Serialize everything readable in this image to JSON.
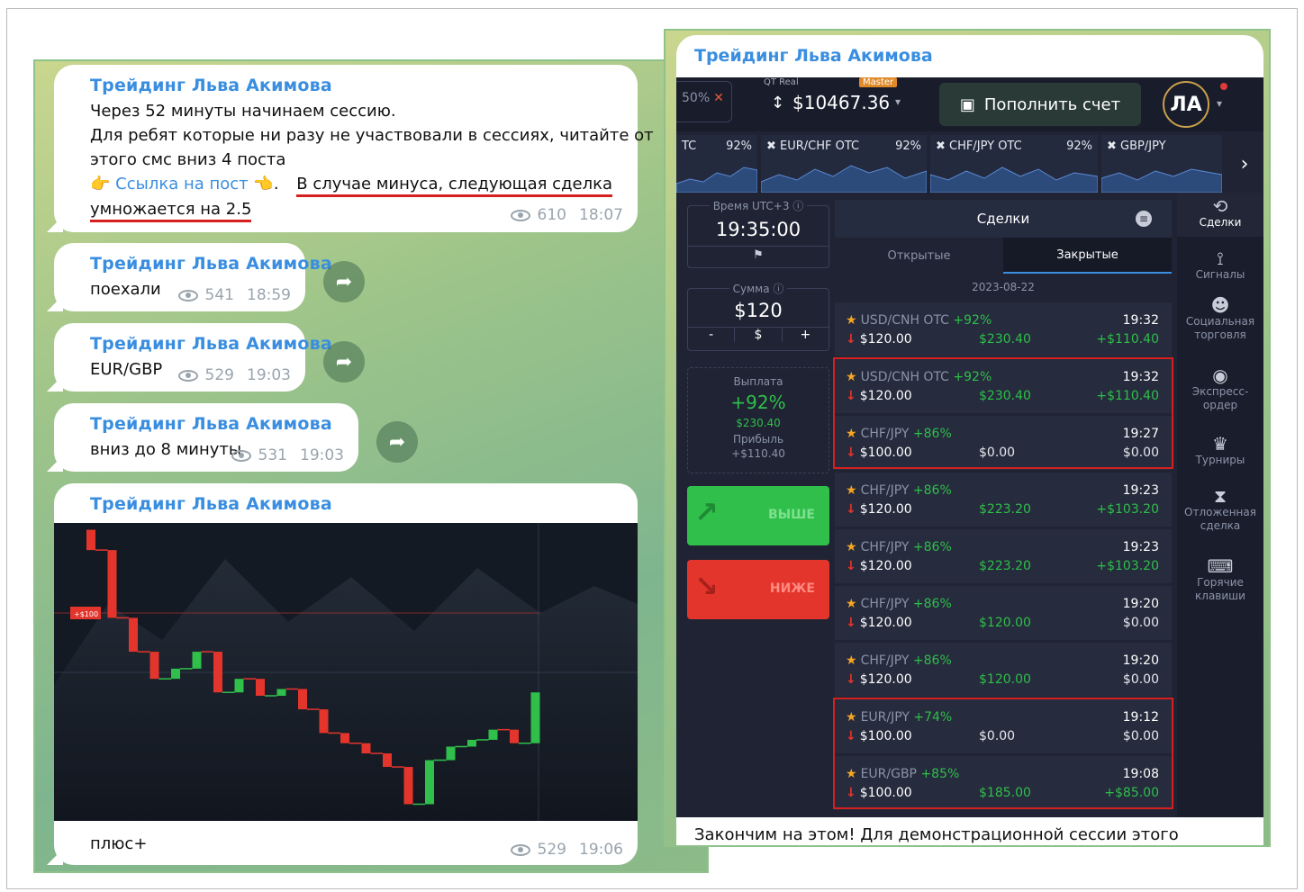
{
  "channel": "Трейдинг Льва Акимова",
  "messages": [
    {
      "lines": [
        "Через 52 минуты начинаем сессию.",
        "Для ребят которые ни разу не участвовали в сессиях, читайте от",
        "этого смс вниз 4 поста"
      ],
      "link_text": "Ссылка на пост",
      "highlight1": "В случае минуса, следующая сделка",
      "highlight2": "умножается на 2.5",
      "views": "610",
      "time": "18:07"
    },
    {
      "text": "поехали",
      "views": "541",
      "time": "18:59"
    },
    {
      "text": "EUR/GBP",
      "views": "529",
      "time": "19:03"
    },
    {
      "text": "вниз до 8 минуты",
      "views": "531",
      "time": "19:03"
    },
    {
      "text": "плюс+",
      "views": "529",
      "time": "19:06"
    }
  ],
  "chart_data": {
    "type": "candlestick",
    "level_label": "+$100",
    "candles": [
      {
        "o": 5.0,
        "c": 4.4
      },
      {
        "o": 4.4,
        "c": 2.4
      },
      {
        "o": 2.4,
        "c": 1.4
      },
      {
        "o": 1.4,
        "c": 0.6
      },
      {
        "o": 0.6,
        "c": 0.9
      },
      {
        "o": 0.9,
        "c": 1.4
      },
      {
        "o": 1.4,
        "c": 0.2
      },
      {
        "o": 0.2,
        "c": 0.6
      },
      {
        "o": 0.6,
        "c": 0.1
      },
      {
        "o": 0.1,
        "c": 0.3
      },
      {
        "o": 0.3,
        "c": -0.3
      },
      {
        "o": -0.3,
        "c": -1.0
      },
      {
        "o": -1.0,
        "c": -1.3
      },
      {
        "o": -1.3,
        "c": -1.6
      },
      {
        "o": -1.6,
        "c": -2.0
      },
      {
        "o": -2.0,
        "c": -3.1
      },
      {
        "o": -3.1,
        "c": -1.8
      },
      {
        "o": -1.8,
        "c": -1.4
      },
      {
        "o": -1.4,
        "c": -1.2
      },
      {
        "o": -1.2,
        "c": -0.9
      },
      {
        "o": -0.9,
        "c": -1.3
      },
      {
        "o": -1.3,
        "c": 0.2
      }
    ]
  },
  "right": {
    "title": "Трейдинг Льва Акимова",
    "pct_label": "50%",
    "account_type": "QT Real",
    "master": "Master",
    "balance": "$10467.36",
    "deposit_label": "Пополнить счет",
    "avatar_initials": "ЛА",
    "assets": [
      {
        "name": "TC",
        "pct": "92%"
      },
      {
        "name": "EUR/CHF OTC",
        "pct": "92%"
      },
      {
        "name": "CHF/JPY OTC",
        "pct": "92%"
      },
      {
        "name": "GBP/JPY",
        "pct": ""
      }
    ],
    "time_label": "Время UTC+3 ⓘ",
    "time_value": "19:35:00",
    "amount_label": "Сумма ⓘ",
    "amount_value": "$120",
    "amount_minus": "-",
    "amount_dollar": "$",
    "amount_plus": "+",
    "payout_label": "Выплата",
    "payout_pct": "+92%",
    "payout_amount": "$230.40",
    "profit_label": "Прибыль",
    "profit_value": "+$110.40",
    "up_label": "ВЫШЕ",
    "down_label": "НИЖЕ",
    "deals_title": "Сделки",
    "tab_open": "Открытые",
    "tab_closed": "Закрытые",
    "date": "2023-08-22",
    "deals": [
      {
        "pair": "USD/CNH OTC",
        "pct": "+92%",
        "amount": "$120.00",
        "payout": "$230.40",
        "time": "19:32",
        "profit": "+$110.40"
      },
      {
        "pair": "USD/CNH OTC",
        "pct": "+92%",
        "amount": "$120.00",
        "payout": "$230.40",
        "time": "19:32",
        "profit": "+$110.40"
      },
      {
        "pair": "CHF/JPY",
        "pct": "+86%",
        "amount": "$100.00",
        "payout": "$0.00",
        "time": "19:27",
        "profit": "$0.00"
      },
      {
        "pair": "CHF/JPY",
        "pct": "+86%",
        "amount": "$120.00",
        "payout": "$223.20",
        "time": "19:23",
        "profit": "+$103.20"
      },
      {
        "pair": "CHF/JPY",
        "pct": "+86%",
        "amount": "$120.00",
        "payout": "$223.20",
        "time": "19:23",
        "profit": "+$103.20"
      },
      {
        "pair": "CHF/JPY",
        "pct": "+86%",
        "amount": "$120.00",
        "payout": "$120.00",
        "time": "19:20",
        "profit": "$0.00"
      },
      {
        "pair": "CHF/JPY",
        "pct": "+86%",
        "amount": "$120.00",
        "payout": "$120.00",
        "time": "19:20",
        "profit": "$0.00"
      },
      {
        "pair": "EUR/JPY",
        "pct": "+74%",
        "amount": "$100.00",
        "payout": "$0.00",
        "time": "19:12",
        "profit": "$0.00"
      },
      {
        "pair": "EUR/GBP",
        "pct": "+85%",
        "amount": "$100.00",
        "payout": "$185.00",
        "time": "19:08",
        "profit": "+$85.00"
      }
    ],
    "nav": [
      {
        "icon": "history-icon",
        "glyph": "⟲",
        "label": "Сделки"
      },
      {
        "icon": "signal-icon",
        "glyph": "⟟",
        "label": "Сигналы"
      },
      {
        "icon": "people-icon",
        "glyph": "☻",
        "label": "Социальная торговля"
      },
      {
        "icon": "express-icon",
        "glyph": "◉",
        "label": "Экспресс-ордер"
      },
      {
        "icon": "trophy-icon",
        "glyph": "♛",
        "label": "Турниры"
      },
      {
        "icon": "hourglass-icon",
        "glyph": "⧗",
        "label": "Отложенная сделка"
      },
      {
        "icon": "keyboard-icon",
        "glyph": "⌨",
        "label": "Горячие клавиши"
      }
    ],
    "footer_text": "Закончим на этом! Для демонстрационной сессии этого"
  },
  "colors": {
    "accent": "#3a8ee0",
    "up": "#2fbf4a",
    "down": "#e4352c",
    "highlight": "#d62020"
  }
}
